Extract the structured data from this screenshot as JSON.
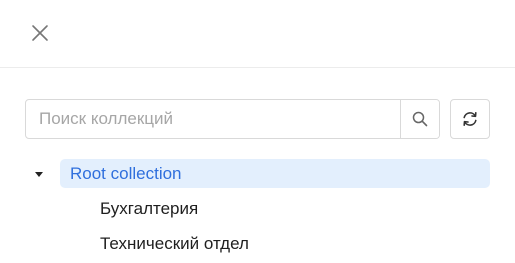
{
  "header": {
    "close_icon": "close-icon"
  },
  "search": {
    "placeholder": "Поиск коллекций",
    "value": "",
    "search_icon": "search-icon",
    "refresh_icon": "refresh-icon"
  },
  "tree": {
    "root": {
      "label": "Root collection",
      "expanded": true,
      "selected": true
    },
    "children": [
      {
        "label": "Бухгалтерия"
      },
      {
        "label": "Технический отдел"
      }
    ]
  },
  "colors": {
    "selected_bg": "#e3effd",
    "selected_text": "#2f6fdd",
    "border": "#d9d9d9"
  }
}
